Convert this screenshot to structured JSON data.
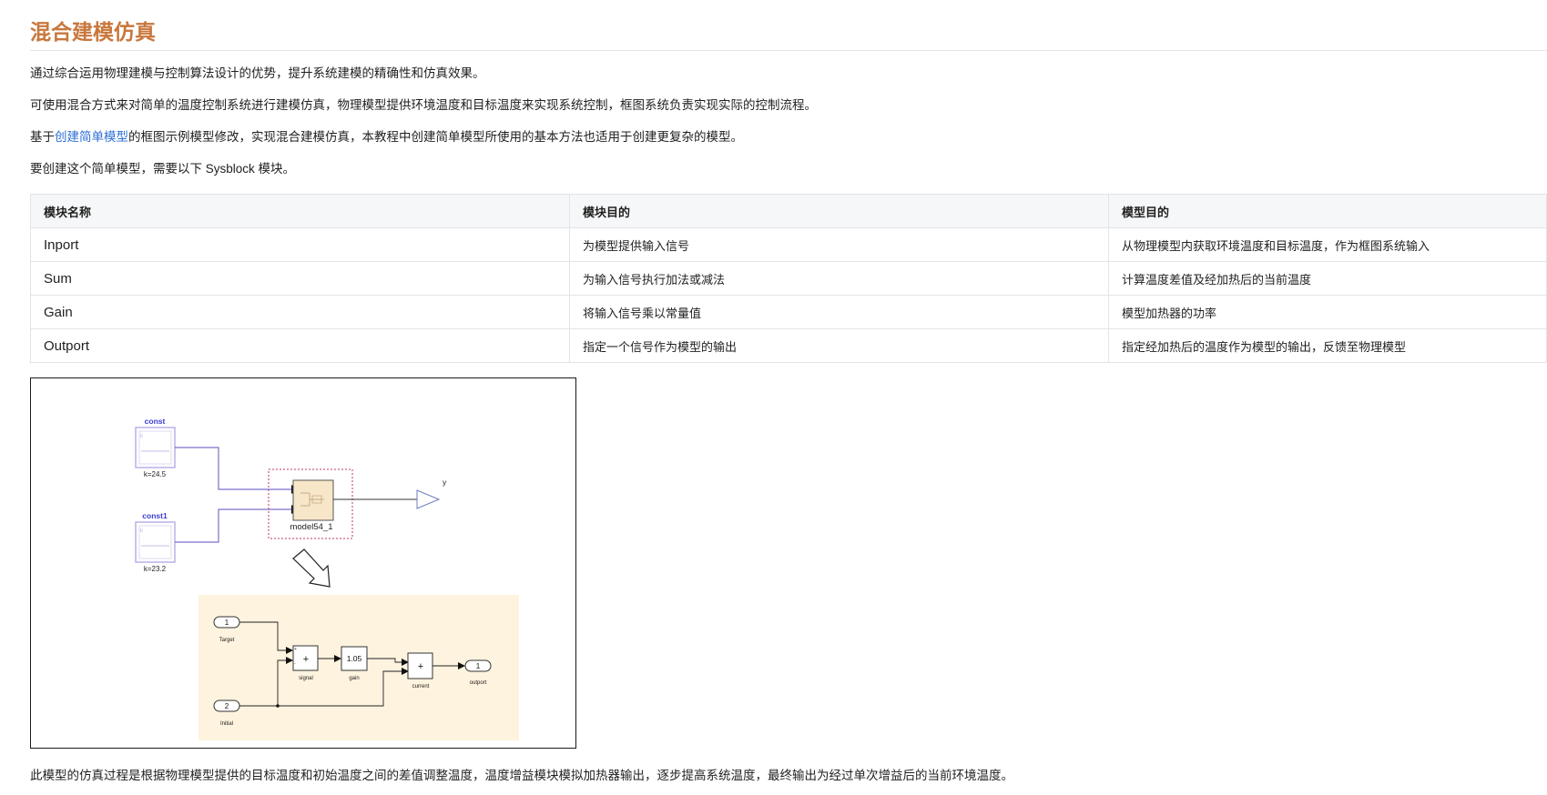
{
  "page": {
    "title": "混合建模仿真"
  },
  "paragraphs": {
    "p1": "通过综合运用物理建模与控制算法设计的优势，提升系统建模的精确性和仿真效果。",
    "p2": "可使用混合方式来对简单的温度控制系统进行建模仿真，物理模型提供环境温度和目标温度来实现系统控制，框图系统负责实现实际的控制流程。",
    "p3_prefix": "基于",
    "p3_link": "创建简单模型",
    "p3_suffix": "的框图示例模型修改，实现混合建模仿真，本教程中创建简单模型所使用的基本方法也适用于创建更复杂的模型。",
    "p4": "要创建这个简单模型，需要以下 Sysblock 模块。",
    "p5": "此模型的仿真过程是根据物理模型提供的目标温度和初始温度之间的差值调整温度，温度增益模块模拟加热器输出，逐步提高系统温度，最终输出为经过单次增益后的当前环境温度。"
  },
  "table": {
    "headers": [
      "模块名称",
      "模块目的",
      "模型目的"
    ],
    "rows": [
      [
        "Inport",
        "为模型提供输入信号",
        "从物理模型内获取环境温度和目标温度，作为框图系统输入"
      ],
      [
        "Sum",
        "为输入信号执行加法或减法",
        "计算温度差值及经加热后的当前温度"
      ],
      [
        "Gain",
        "将输入信号乘以常量值",
        "模型加热器的功率"
      ],
      [
        "Outport",
        "指定一个信号作为模型的输出",
        "指定经加热后的温度作为模型的输出，反馈至物理模型"
      ]
    ]
  },
  "diagram": {
    "top": {
      "const_label": "const",
      "const_value": "k=24.5",
      "const1_label": "const1",
      "const1_value": "k=23.2",
      "subsystem_label": "model54_1",
      "output_label": "y"
    },
    "bottom": {
      "inport1_number": "1",
      "inport1_label": "Target",
      "inport2_number": "2",
      "inport2_label": "Initial",
      "sum1_symbol": "+",
      "sum1_label": "signal",
      "gain_value": "1.05",
      "gain_label": "gain",
      "sum2_symbol": "+",
      "sum2_label": "current",
      "outport_number": "1",
      "outport_label": "outport"
    },
    "colors": {
      "title": "#c8773c",
      "link": "#2f6fd6",
      "const_label": "#3a3ad0",
      "signal_line": "#7b6fc9",
      "subsystem_fill": "#f7e6c8",
      "subsystem_border": "#c0395a",
      "bottom_bg": "#fdf3de"
    },
    "icons": [
      "down-arrow-icon",
      "scope-icon",
      "subsystem-icon",
      "outport-triangle-icon"
    ]
  }
}
